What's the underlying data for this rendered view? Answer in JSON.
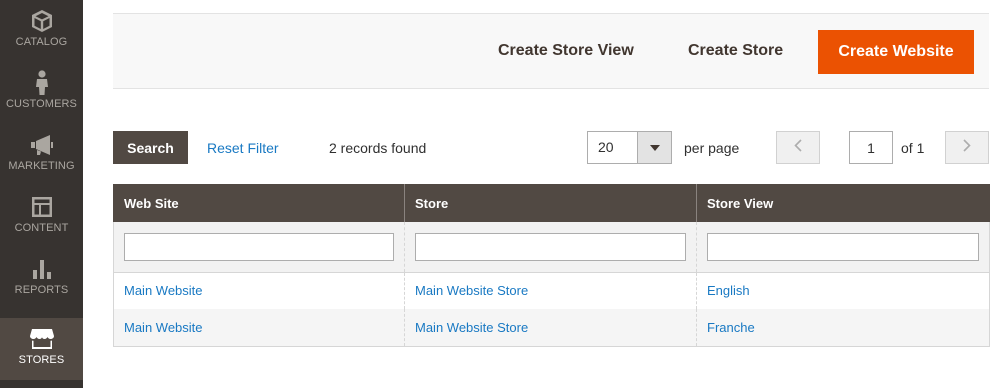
{
  "sidebar": {
    "items": [
      {
        "label": "CATALOG",
        "icon": "cube-icon"
      },
      {
        "label": "CUSTOMERS",
        "icon": "person-icon"
      },
      {
        "label": "MARKETING",
        "icon": "megaphone-icon"
      },
      {
        "label": "CONTENT",
        "icon": "layout-icon"
      },
      {
        "label": "REPORTS",
        "icon": "bar-chart-icon"
      },
      {
        "label": "STORES",
        "icon": "storefront-icon",
        "active": true
      }
    ]
  },
  "actions": {
    "create_store_view": "Create Store View",
    "create_store": "Create Store",
    "create_website": "Create Website"
  },
  "toolbar": {
    "search_label": "Search",
    "reset_filter_label": "Reset Filter",
    "records_found": "2 records found",
    "per_page_value": "20",
    "per_page_label": "per page",
    "current_page": "1",
    "of_pages": "of 1"
  },
  "grid": {
    "columns": [
      "Web Site",
      "Store",
      "Store View"
    ],
    "rows": [
      {
        "website": "Main Website",
        "store": "Main Website Store",
        "store_view": "English"
      },
      {
        "website": "Main Website",
        "store": "Main Website Store",
        "store_view": "Franche"
      }
    ]
  },
  "colors": {
    "sidebar_bg": "#373330",
    "sidebar_active": "#514943",
    "primary_button": "#eb5202",
    "grid_header": "#514943",
    "link": "#1979c3"
  }
}
